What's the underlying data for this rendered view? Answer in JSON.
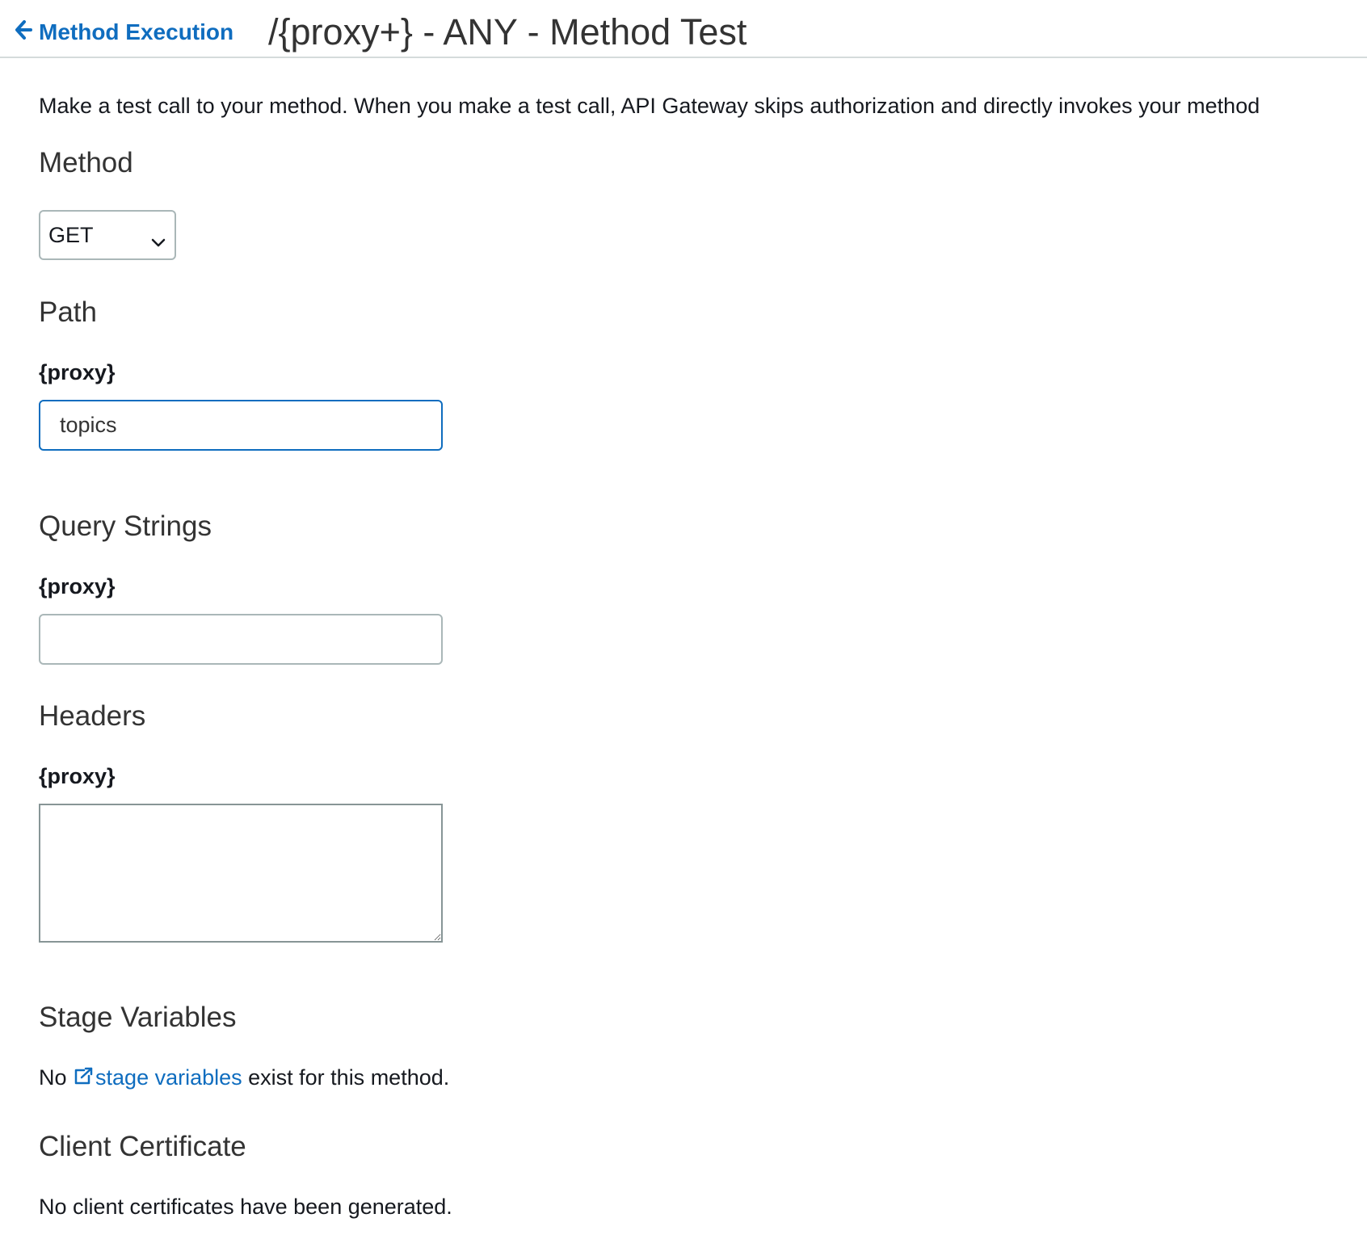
{
  "header": {
    "back_label": "Method Execution",
    "title": "/{proxy+} - ANY - Method Test"
  },
  "intro": "Make a test call to your method. When you make a test call, API Gateway skips authorization and directly invokes your method",
  "method": {
    "title": "Method",
    "selected": "GET"
  },
  "path": {
    "title": "Path",
    "param_label": "{proxy}",
    "value": "topics"
  },
  "query": {
    "title": "Query Strings",
    "param_label": "{proxy}",
    "value": ""
  },
  "headers": {
    "title": "Headers",
    "param_label": "{proxy}",
    "value": ""
  },
  "stage_variables": {
    "title": "Stage Variables",
    "prefix": "No ",
    "link_text": "stage variables",
    "suffix": " exist for this method."
  },
  "client_certificate": {
    "title": "Client Certificate",
    "text": "No client certificates have been generated."
  },
  "colors": {
    "link": "#0f6dbf",
    "focus_border": "#0f6dbf"
  },
  "icons": {
    "back": "arrow-left-icon",
    "select": "chevron-down-icon",
    "external": "external-link-icon"
  }
}
